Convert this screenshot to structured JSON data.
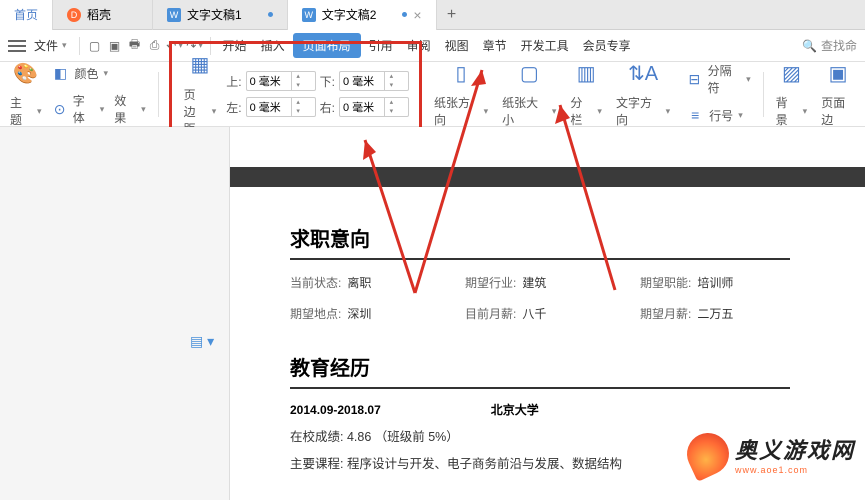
{
  "tabs": {
    "home": "首页",
    "docke": "稻壳",
    "doc1": "文字文稿1",
    "doc2": "文字文稿2"
  },
  "menubar": {
    "file": "文件",
    "start": "开始",
    "insert": "插入",
    "page_layout": "页面布局",
    "reference": "引用",
    "review": "审阅",
    "view": "视图",
    "chapter": "章节",
    "devtools": "开发工具",
    "vip": "会员专享",
    "search_ph": "查找命"
  },
  "ribbon": {
    "theme": "主题",
    "color": "颜色",
    "font": "字体",
    "effect": "效果",
    "margins": "页边距",
    "top": "上:",
    "bottom": "下:",
    "left": "左:",
    "right": "右:",
    "val_top": "0 毫米",
    "val_bottom": "0 毫米",
    "val_left": "0 毫米",
    "val_right": "0 毫米",
    "paper_dir": "纸张方向",
    "paper_size": "纸张大小",
    "columns": "分栏",
    "text_dir": "文字方向",
    "separator": "分隔符",
    "line_no": "行号",
    "background": "背景",
    "page_border": "页面边"
  },
  "resume": {
    "sec1": "求职意向",
    "status_l": "当前状态:",
    "status_v": "离职",
    "industry_l": "期望行业:",
    "industry_v": "建筑",
    "position_l": "期望职能:",
    "position_v": "培训师",
    "location_l": "期望地点:",
    "location_v": "深圳",
    "salary_now_l": "目前月薪:",
    "salary_now_v": "八千",
    "salary_exp_l": "期望月薪:",
    "salary_exp_v": "二万五",
    "sec2": "教育经历",
    "edu_date": "2014.09-2018.07",
    "edu_school": "北京大学",
    "edu_grade": "在校成绩:  4.86 （班级前 5%）",
    "edu_course": "主要课程:  程序设计与开发、电子商务前沿与发展、数据结构"
  },
  "watermark": {
    "cn": "奥义游戏网",
    "en": "www.aoe1.com"
  }
}
